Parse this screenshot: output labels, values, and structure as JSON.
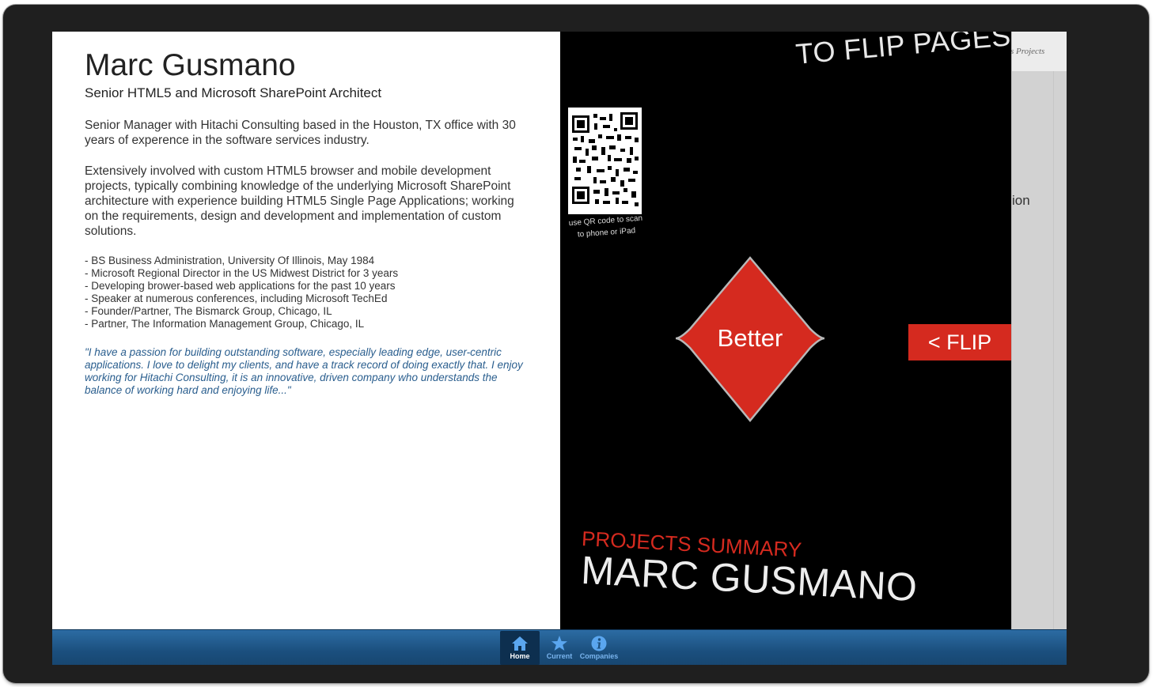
{
  "profile": {
    "name": "Marc Gusmano",
    "title": "Senior HTML5 and Microsoft SharePoint Architect",
    "paragraph1": "Senior Manager with Hitachi Consulting based in the Houston, TX office with 30 years of experence in the software services industry.",
    "paragraph2": "Extensively involved with custom HTML5 browser and mobile development projects, typically combining knowledge of the underlying Microsoft SharePoint architecture with experience building HTML5 Single Page Applications; working on the requirements, design and development and implementation of custom solutions.",
    "bullets": [
      "- BS Business Administration, University Of Illinois, May 1984",
      "- Microsoft Regional Director in the US Midwest District for 3 years",
      "- Developing brower-based web applications for the past 10 years",
      "- Speaker at numerous conferences, including Microsoft TechEd",
      "- Founder/Partner, The Bismarck Group, Chicago, IL",
      "- Partner, The Information Management Group, Chicago, IL"
    ],
    "quote": "\"I have a passion for building outstanding software, especially leading edge, user-centric applications. I love to delight my clients, and have a track record of doing exactly that. I enjoy working for Hitachi Consulting, it is an innovative, driven company who understands the balance of working hard and enjoying life...\""
  },
  "flipbook": {
    "top_text": "TO FLIP PAGES",
    "qr_caption_line1": "use QR code to scan",
    "qr_caption_line2": "to phone or iPad",
    "diamond_label": "Better",
    "flip_button": "< FLIP",
    "summary_label": "PROJECTS SUMMARY",
    "summary_name": "MARC GUSMANO"
  },
  "background_page": {
    "fragment_top": "s Projects",
    "fragment_mid": "ion"
  },
  "nav": {
    "items": [
      {
        "label": "Home",
        "icon": "home-icon",
        "active": true
      },
      {
        "label": "Current",
        "icon": "star-icon",
        "active": false
      },
      {
        "label": "Companies",
        "icon": "info-icon",
        "active": false
      }
    ]
  },
  "colors": {
    "accent_red": "#d52a1f",
    "nav_blue": "#1b4f7e",
    "quote_blue": "#2a5e8e"
  }
}
